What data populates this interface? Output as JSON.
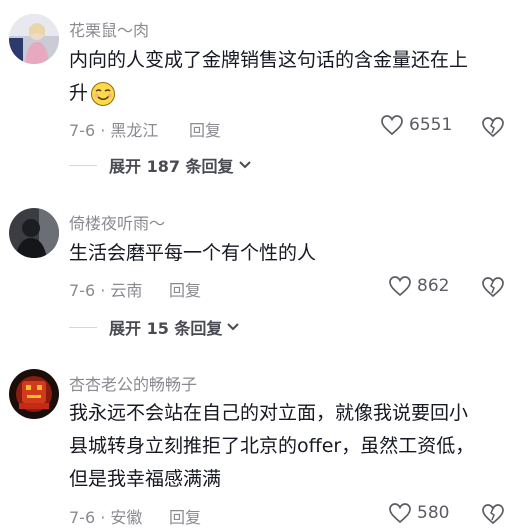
{
  "comments": [
    {
      "username": "花栗鼠～肉",
      "text_line1": "内向的人变成了金牌销售这句话的含金量还在上",
      "text_line2": "升",
      "emoji": "smirk-face",
      "date_location": "7-6 · 黑龙江",
      "reply_label": "回复",
      "likes": "6551",
      "expand_label": "展开 187 条回复"
    },
    {
      "username": "倚楼夜听雨～",
      "text_line1": "生活会磨平每一个有个性的人",
      "date_location": "7-6 · 云南",
      "reply_label": "回复",
      "likes": "862",
      "expand_label": "展开 15 条回复"
    },
    {
      "username": "杏杏老公的畅畅子",
      "text_line1": "我永远不会站在自己的对立面，就像我说要回小",
      "text_line2": "县城转身立刻推拒了北京的offer，虽然工资低，",
      "text_line3": "但是我幸福感满满",
      "date_location": "7-6 · 安徽",
      "reply_label": "回复",
      "likes": "580"
    }
  ],
  "colors": {
    "primary_text": "#161823",
    "secondary_text": "#8a8b91",
    "background": "#ffffff"
  }
}
